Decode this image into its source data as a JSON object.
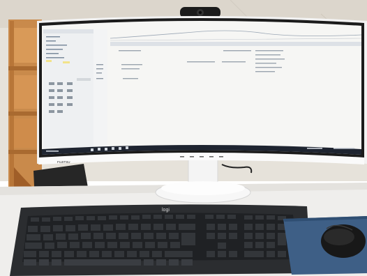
{
  "photo": {
    "monitor": {
      "brand": "FUJITSU"
    },
    "keyboard": {
      "brand": "logi"
    }
  },
  "colors": {
    "wall": "#e8e4dc",
    "wood_shelf": "#c9894a",
    "desk": "#efeeec",
    "monitor_bezel": "#1c1c1c",
    "keyboard": "#2b2d30",
    "mousepad": "#3e5f86",
    "mouse": "#1a1a1a",
    "screen_bg": "#f6f6f4",
    "taskbar": "#1e2430"
  }
}
